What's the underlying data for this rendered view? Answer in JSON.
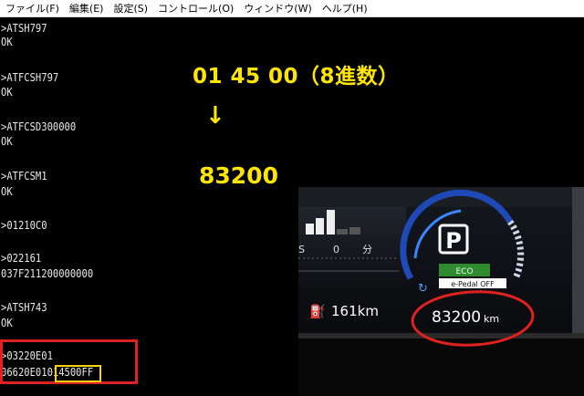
{
  "menu": [
    {
      "label": "ファイル(F)"
    },
    {
      "label": "編集(E)"
    },
    {
      "label": "設定(S)"
    },
    {
      "label": "コントロール(O)"
    },
    {
      "label": "ウィンドウ(W)"
    },
    {
      "label": "ヘルプ(H)"
    }
  ],
  "terminal": {
    "lines": [
      ">ATSH797",
      "OK",
      ">ATFCSH797",
      "OK",
      ">ATFCSD300000",
      "OK",
      ">ATFCSM1",
      "OK",
      ">01210C0",
      ">022161",
      "037F211200000000",
      ">ATSH743",
      "OK",
      ">03220E01",
      "06620E01014500FF"
    ]
  },
  "annotation": {
    "hex_value": "01 45 00（8進数）",
    "arrow": "↓",
    "decimal_value": "83200"
  },
  "dashboard": {
    "s_label": "S",
    "zero": "0",
    "min": "分",
    "range": "161km",
    "gear": "P",
    "eco": "ECO",
    "epedal": "e-Pedal OFF",
    "odometer": "83200",
    "odo_unit": "km"
  },
  "colors": {
    "annotation": "#ffe600",
    "highlight_red": "#e0221e",
    "highlight_yellow": "#ffd400",
    "terminal_bg": "#000000",
    "terminal_fg": "#e8e8e8"
  }
}
